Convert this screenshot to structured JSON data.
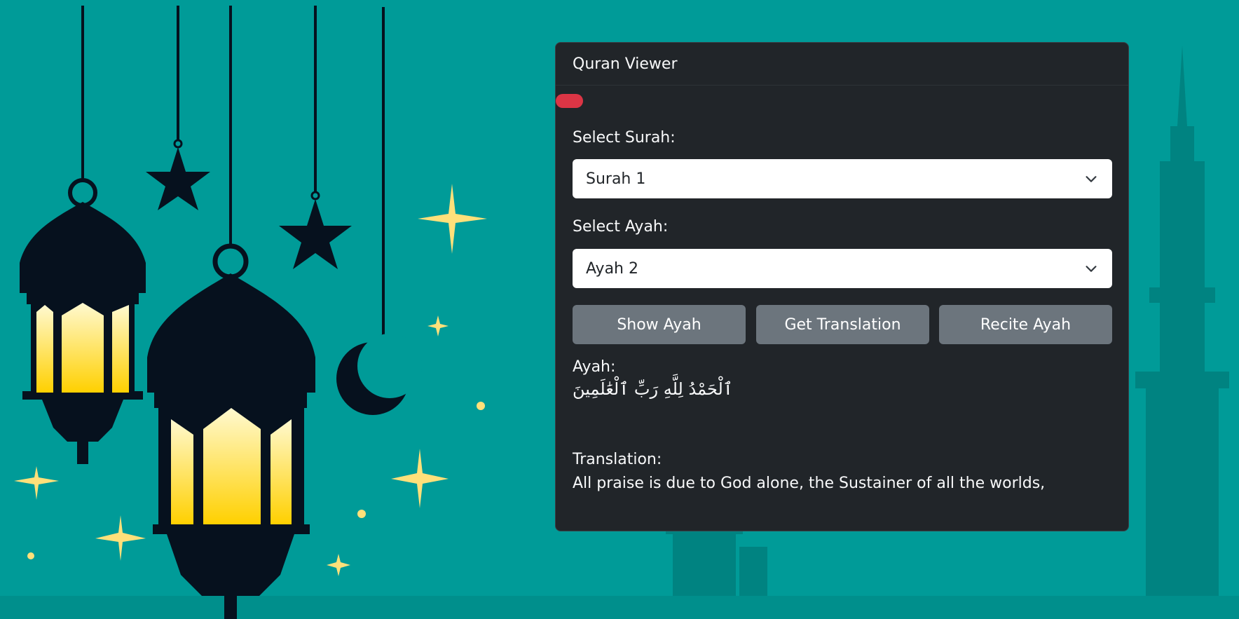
{
  "card": {
    "title": "Quran Viewer"
  },
  "surah": {
    "label": "Select Surah:",
    "selected": "Surah 1"
  },
  "ayah_select": {
    "label": "Select Ayah:",
    "selected": "Ayah 2"
  },
  "buttons": {
    "show": "Show Ayah",
    "translate": "Get Translation",
    "recite": "Recite Ayah"
  },
  "ayah": {
    "label": "Ayah:",
    "text": "ٱلْحَمْدُ لِلَّهِ رَبِّ ٱلْعَٰلَمِينَ"
  },
  "translation": {
    "label": "Translation:",
    "text": "All praise is due to God alone, the Sustainer of all the worlds,"
  },
  "colors": {
    "background": "#009b98",
    "card": "#212529",
    "button": "#6c757d",
    "alert": "#dc3545",
    "lamp_glow": "#ffd600",
    "silhouette": "#06111e"
  }
}
